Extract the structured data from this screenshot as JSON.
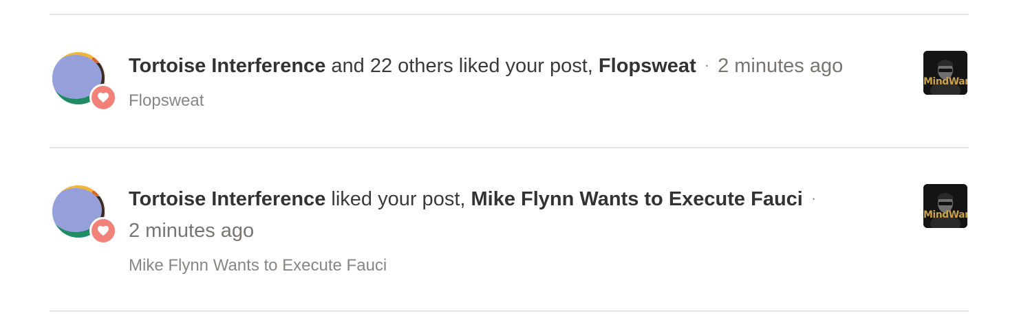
{
  "notifications": [
    {
      "actor": "Tortoise Interference",
      "action": "and 22 others liked your post,",
      "post_title": "Flopsweat",
      "separator": "·",
      "time": "2 minutes ago",
      "subtitle": "Flopsweat",
      "badge_icon": "heart-icon",
      "thumbnail_text": "MindWar"
    },
    {
      "actor": "Tortoise Interference",
      "action": "liked your post,",
      "post_title": "Mike Flynn Wants to Execute Fauci",
      "separator": "·",
      "time": "2 minutes ago",
      "subtitle": "Mike Flynn Wants to Execute Fauci",
      "badge_icon": "heart-icon",
      "thumbnail_text": "MindWar"
    }
  ],
  "colors": {
    "badge": "#f28179",
    "avatar_main": "#95a0db",
    "avatar_green": "#1f8a63",
    "avatar_yellow": "#efb63a",
    "avatar_orange": "#d9662b",
    "divider": "#e6e6e6",
    "thumb_bg": "#141414",
    "thumb_text": "#c9a14a"
  }
}
